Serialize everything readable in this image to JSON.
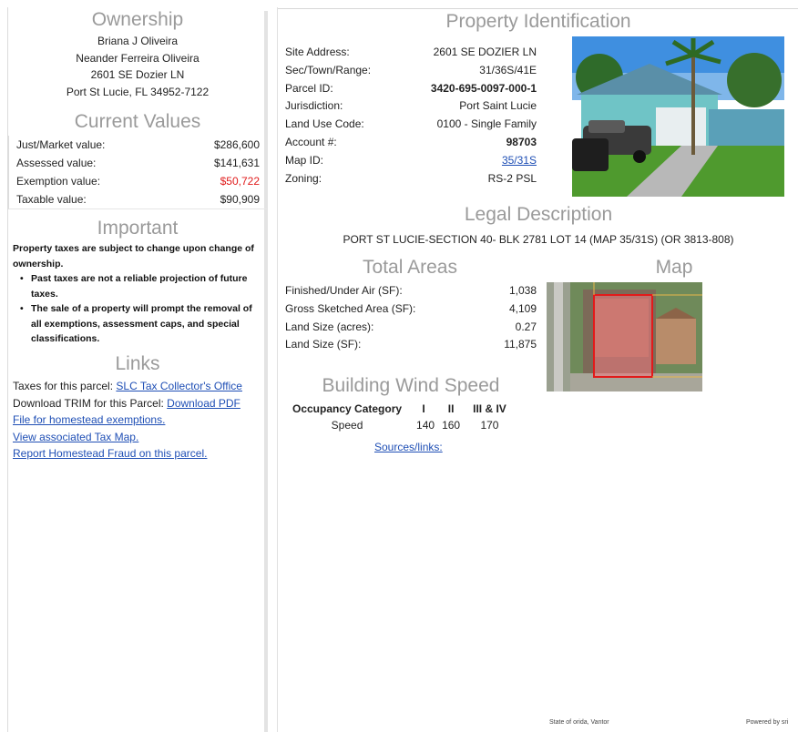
{
  "ownership": {
    "title": "Ownership",
    "name1": "Briana J Oliveira",
    "name2": "Neander Ferreira Oliveira",
    "address1": "2601 SE Dozier LN",
    "address2": "Port St Lucie, FL 34952-7122"
  },
  "current_values": {
    "title": "Current Values",
    "rows": [
      {
        "label": "Just/Market value:",
        "value": "$286,600"
      },
      {
        "label": "Assessed value:",
        "value": "$141,631"
      },
      {
        "label": "Exemption value:",
        "value": "$50,722"
      },
      {
        "label": "Taxable value:",
        "value": "$90,909"
      }
    ]
  },
  "important": {
    "title": "Important",
    "intro": "Property taxes are subject to change upon change of ownership.",
    "bullets": [
      "Past taxes are not a reliable projection of future taxes.",
      "The sale of a property will prompt the removal of all exemptions, assessment caps, and special classifications."
    ]
  },
  "links": {
    "title": "Links",
    "taxes_label": "Taxes for this parcel: ",
    "taxes_link": "SLC Tax Collector's Office",
    "trim_label": "Download TRIM for this Parcel: ",
    "trim_link": "Download PDF",
    "homestead_link": "File for homestead exemptions.",
    "taxmap_link": "View associated Tax Map.",
    "fraud_link": "Report Homestead Fraud on this parcel."
  },
  "property_id": {
    "title": "Property Identification",
    "rows": [
      {
        "label": "Site Address:",
        "value": "2601 SE DOZIER LN"
      },
      {
        "label": "Sec/Town/Range:",
        "value": "31/36S/41E"
      },
      {
        "label": "Parcel ID:",
        "value": "3420-695-0097-000-1"
      },
      {
        "label": "Jurisdiction:",
        "value": "Port Saint Lucie"
      },
      {
        "label": "Land Use Code:",
        "value": "0100 - Single Family"
      },
      {
        "label": "Account #:",
        "value": "98703"
      },
      {
        "label": "Map ID:",
        "value": "35/31S"
      },
      {
        "label": "Zoning:",
        "value": "RS-2 PSL"
      }
    ]
  },
  "legal": {
    "title": "Legal Description",
    "text": "PORT ST LUCIE-SECTION 40- BLK 2781 LOT 14 (MAP 35/31S) (OR 3813-808)"
  },
  "total_areas": {
    "title": "Total Areas",
    "rows": [
      {
        "label": "Finished/Under Air (SF):",
        "value": "1,038"
      },
      {
        "label": "Gross Sketched Area (SF):",
        "value": "4,109"
      },
      {
        "label": "Land Size (acres):",
        "value": "0.27"
      },
      {
        "label": "Land Size (SF):",
        "value": "11,875"
      }
    ]
  },
  "map": {
    "title": "Map"
  },
  "wind": {
    "title": "Building Wind Speed",
    "header": [
      "Occupancy Category",
      "I",
      "II",
      "III & IV"
    ],
    "row": [
      "Speed",
      "140",
      "160",
      "170"
    ],
    "sources": "Sources/links:"
  },
  "footer": {
    "left": "State of   orida, Vantor",
    "right": "Powered by  sri"
  },
  "colors": {
    "title_gray": "#9a9a9a",
    "link_blue": "#1f4fb5",
    "exemption_red": "#e01b1b"
  }
}
